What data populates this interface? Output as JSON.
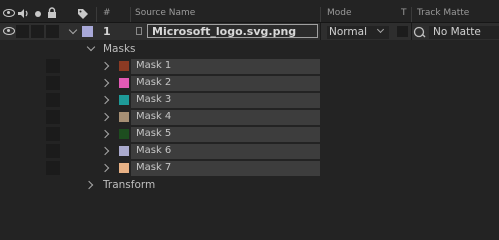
{
  "header": {
    "index_col": "#",
    "source_col": "Source Name",
    "mode_col": "Mode",
    "t_col": "T",
    "track_col": "Track Matte"
  },
  "layer": {
    "number": "1",
    "label_color": "#a8a8d8",
    "name": "Microsoft_logo.svg.png",
    "mode": "Normal",
    "track_matte": "No Matte"
  },
  "masks_group": {
    "label": "Masks"
  },
  "masks": [
    {
      "name": "Mask 1",
      "color": "#8b3a23"
    },
    {
      "name": "Mask 2",
      "color": "#e35ab5"
    },
    {
      "name": "Mask 3",
      "color": "#1e9a98"
    },
    {
      "name": "Mask 4",
      "color": "#a68f74"
    },
    {
      "name": "Mask 5",
      "color": "#1d4d1f"
    },
    {
      "name": "Mask 6",
      "color": "#a9a9cc"
    },
    {
      "name": "Mask 7",
      "color": "#e7b185"
    }
  ],
  "transform_group": {
    "label": "Transform"
  },
  "icons": {
    "eye": "eye-icon",
    "audio": "speaker-icon",
    "solo": "solo-dot-icon",
    "lock": "lock-icon",
    "label": "label-tag-icon"
  }
}
